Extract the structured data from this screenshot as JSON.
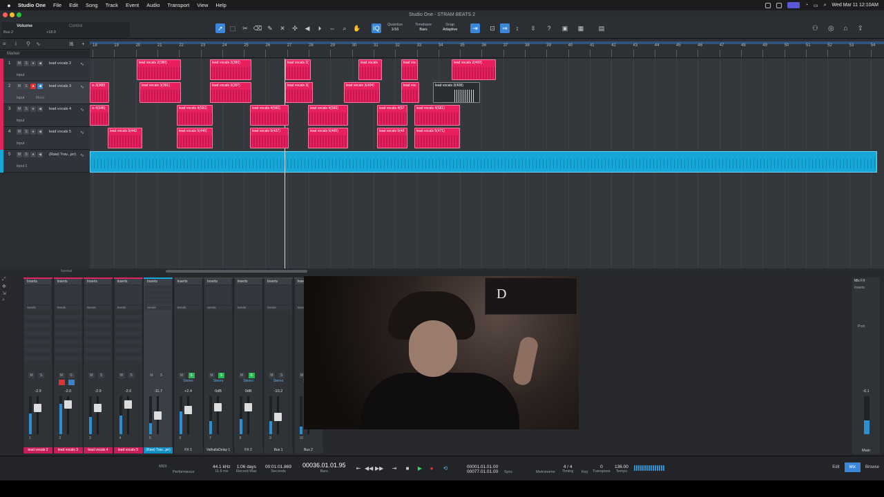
{
  "menubar": {
    "apple": "",
    "items": [
      "Studio One",
      "File",
      "Edit",
      "Song",
      "Track",
      "Event",
      "Audio",
      "Transport",
      "View",
      "Help"
    ],
    "clock": "Wed Mar 11  12:10AM"
  },
  "window": {
    "title": "Studio One - STRAM BEATS 2"
  },
  "inspector": {
    "label": "Volume",
    "control": "Control",
    "bus": "Bus 2",
    "value": "+18.0"
  },
  "toolbar": {
    "quantize_label": "Quantize",
    "quantize_value": "1/16",
    "timebase_label": "Timebase",
    "timebase_value": "Bars",
    "snap_label": "Snap",
    "snap_value": "Adaptive"
  },
  "arrange": {
    "marker_label": "Marker",
    "ruler_ticks": [
      "18",
      "19",
      "20",
      "21",
      "22",
      "23",
      "24",
      "25",
      "26",
      "27",
      "28",
      "29",
      "30",
      "31",
      "32",
      "33",
      "34",
      "35",
      "36",
      "37",
      "38",
      "39",
      "40",
      "41",
      "42",
      "43",
      "44",
      "45",
      "46",
      "47",
      "48",
      "49",
      "50",
      "51",
      "52",
      "53",
      "54"
    ],
    "footer_mode": "Normal"
  },
  "tracks": [
    {
      "num": "1",
      "name": "lead vocals 2",
      "input": "Input"
    },
    {
      "num": "2",
      "name": "lead vocals 3",
      "input": "Input",
      "mode": "Mono"
    },
    {
      "num": "3",
      "name": "lead vocals 4",
      "input": "Input"
    },
    {
      "num": "4",
      "name": "lead vocals 5",
      "input": "Input"
    },
    {
      "num": "5",
      "name": "(Raw) Trav...jer)",
      "input": "Input 1"
    }
  ],
  "clips": [
    {
      "label": "lead vocals 2(380)"
    },
    {
      "label": "lead vocals 2(390)"
    },
    {
      "label": "lead vocals 2("
    },
    {
      "label": "lead vocals"
    },
    {
      "label": "lead voc"
    },
    {
      "label": "lead vocals 2(409)"
    },
    {
      "label": "is 3(380)"
    },
    {
      "label": "lead vocals 3(391)"
    },
    {
      "label": "lead vocals 3(397)"
    },
    {
      "label": "lead vocals 3("
    },
    {
      "label": "lead vocals 3(404)"
    },
    {
      "label": "lead voc"
    },
    {
      "label": "lead vocals 3(408)"
    },
    {
      "label": "is 4(546)"
    },
    {
      "label": "lead vocals 4(550)"
    },
    {
      "label": "lead vocals 4(560)"
    },
    {
      "label": "lead vocals 4(566)"
    },
    {
      "label": "lead vocals 4(57"
    },
    {
      "label": "lead vocals 4(581)"
    },
    {
      "label": "lead vocals 5(442"
    },
    {
      "label": "lead vocals 5(446)"
    },
    {
      "label": "lead vocals 5(457)"
    },
    {
      "label": "lead vocals 5(465)"
    },
    {
      "label": "lead vocals 5(46"
    },
    {
      "label": "lead vocals 5(471)"
    }
  ],
  "mixer": {
    "channels": [
      {
        "name": "lead vocals 2",
        "vol": "-2.9",
        "num": "1"
      },
      {
        "name": "lead vocals 3",
        "vol": "-2.0",
        "num": "2"
      },
      {
        "name": "lead vocals 4",
        "vol": "-2.9",
        "num": "3"
      },
      {
        "name": "lead vocals 5",
        "vol": "-2.0",
        "num": "4"
      },
      {
        "name": "(Raw) Trav...jer)",
        "vol": "-11.7",
        "num": "5"
      },
      {
        "name": "FX 1",
        "vol": "+2.4",
        "num": "6"
      },
      {
        "name": "ValhallaDelay 1",
        "vol": "0dB",
        "num": "7"
      },
      {
        "name": "FX 2",
        "vol": "0dB",
        "num": "8"
      },
      {
        "name": "Bus 1",
        "vol": "-10.2",
        "num": "9"
      },
      {
        "name": "Bus 2",
        "vol": "",
        "num": "10"
      }
    ],
    "inserts_label": "Inserts",
    "sends_label": "Sends",
    "stereo_label": "Stereo",
    "main": {
      "label": "Mix FX",
      "inserts": "Inserts",
      "post": "Post",
      "vol": "-0.1",
      "name": "Main"
    }
  },
  "transport": {
    "sample_rate": "44.1 kHz",
    "latency": "11.6 ms",
    "record_max": "1:06 days",
    "record_max_label": "Record Max",
    "seconds": "00:01:01.869",
    "seconds_label": "Seconds",
    "bars": "00036.01.01.95",
    "bars_label": "Bars",
    "loop_start": "00001.01.01.00",
    "loop_end": "00077.01.01.00",
    "sync_label": "Sync",
    "metronome_label": "Metronome",
    "timing": "4 / 4",
    "timing_label": "Timing",
    "key_label": "Key",
    "transpose": "0",
    "transpose_label": "Transpose",
    "tempo": "136.00",
    "tempo_label": "Tempo",
    "midi_label": "MIDI",
    "performance_label": "Performance",
    "tabs": [
      "Edit",
      "Mix",
      "Browse"
    ]
  }
}
